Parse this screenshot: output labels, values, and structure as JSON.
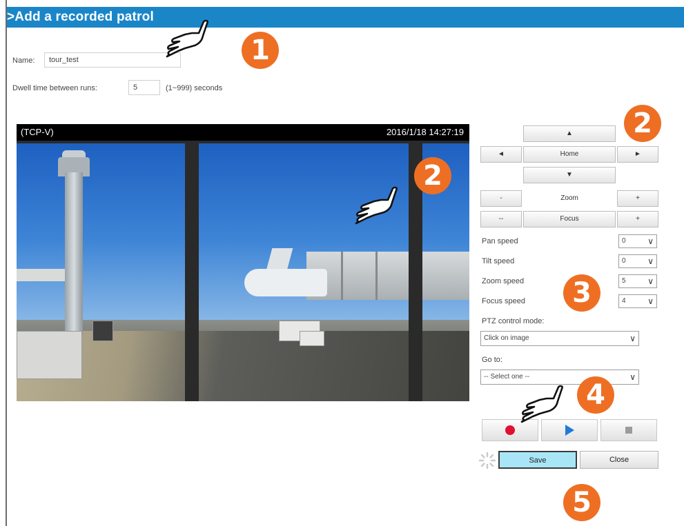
{
  "header": {
    "title": ">Add a recorded patrol"
  },
  "form": {
    "name_label": "Name:",
    "name_value": "tour_test",
    "dwell_label": "Dwell time between runs:",
    "dwell_value": "5",
    "dwell_hint": "(1~999) seconds"
  },
  "video": {
    "stream_label": "(TCP-V)",
    "timestamp": "2016/1/18 14:27:19"
  },
  "ptz": {
    "up_glyph": "▲",
    "down_glyph": "▼",
    "left_glyph": "◄",
    "right_glyph": "►",
    "home_label": "Home",
    "zoom_label": "Zoom",
    "focus_label": "Focus",
    "minus_label": "-",
    "minus2_label": "--",
    "plus_label": "+"
  },
  "speeds": [
    {
      "label": "Pan speed",
      "value": "0"
    },
    {
      "label": "Tilt speed",
      "value": "0"
    },
    {
      "label": "Zoom speed",
      "value": "5"
    },
    {
      "label": "Focus speed",
      "value": "4"
    }
  ],
  "control_mode": {
    "label": "PTZ control mode:",
    "value": "Click on image"
  },
  "goto": {
    "label": "Go to:",
    "value": "-- Select one --"
  },
  "buttons": {
    "save": "Save",
    "close": "Close"
  },
  "badges": [
    "1",
    "2",
    "2",
    "3",
    "4",
    "5"
  ],
  "colors": {
    "header": "#1a86c8",
    "badge": "#ee6f24",
    "save_bg": "#a8e6f7",
    "record": "#e0102f",
    "play": "#1f7bd6"
  }
}
